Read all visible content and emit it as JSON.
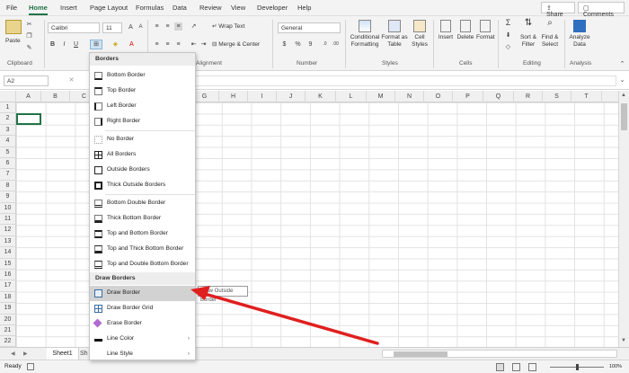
{
  "tabs": [
    "File",
    "Home",
    "Insert",
    "Page Layout",
    "Formulas",
    "Data",
    "Review",
    "View",
    "Developer",
    "Help"
  ],
  "share_label": "Share",
  "comments_label": "Comments",
  "clipboard": {
    "paste": "Paste",
    "label": "Clipboard"
  },
  "font": {
    "name": "Calibri",
    "size": "11",
    "bold": "B",
    "italic": "I",
    "underline": "U"
  },
  "alignment": {
    "wrap": "Wrap Text",
    "merge": "Merge & Center",
    "label": "Alignment"
  },
  "number": {
    "format": "General",
    "currency": "$",
    "percent": "%",
    "comma": "9",
    "label": "Number"
  },
  "styles": {
    "conditional": [
      "Conditional",
      "Formatting"
    ],
    "table": [
      "Format as",
      "Table"
    ],
    "cell": [
      "Cell",
      "Styles"
    ],
    "label": "Styles"
  },
  "cells": {
    "insert": "Insert",
    "delete": "Delete",
    "format": "Format",
    "label": "Cells"
  },
  "editing": {
    "sort": [
      "Sort &",
      "Filter"
    ],
    "find": [
      "Find &",
      "Select"
    ],
    "label": "Editing",
    "sum": "Σ"
  },
  "analysis": {
    "analyze": [
      "Analyze",
      "Data"
    ],
    "label": "Analysis"
  },
  "formula_bar": {
    "name_box": "A2",
    "fx": "fx"
  },
  "columns": [
    "A",
    "B",
    "C",
    "D",
    "E",
    "F",
    "G",
    "H",
    "I",
    "J",
    "K",
    "L",
    "M",
    "N",
    "O",
    "P",
    "Q",
    "R",
    "S",
    "T"
  ],
  "rows": [
    "1",
    "2",
    "3",
    "4",
    "5",
    "6",
    "7",
    "8",
    "9",
    "10",
    "11",
    "12",
    "13",
    "14",
    "15",
    "16",
    "17",
    "18",
    "19",
    "20",
    "21",
    "22"
  ],
  "sheet_tabs": [
    "Sheet1",
    "Sh"
  ],
  "status": {
    "ready": "Ready",
    "zoom": "100%"
  },
  "menu": {
    "borders_heading": "Borders",
    "draw_heading": "Draw Borders",
    "items_a": [
      "Bottom Border",
      "Top Border",
      "Left Border",
      "Right Border"
    ],
    "items_b": [
      "No Border",
      "All Borders",
      "Outside Borders",
      "Thick Outside Borders"
    ],
    "items_c": [
      "Bottom Double Border",
      "Thick Bottom Border",
      "Top and Bottom Border",
      "Top and Thick Bottom Border",
      "Top and Double Bottom Border"
    ],
    "items_d": [
      "Draw Border",
      "Draw Border Grid",
      "Erase Border",
      "Line Color",
      "Line Style"
    ]
  },
  "tooltip": "Draw Outside Border",
  "colors": {
    "accent": "#217346",
    "arrow": "#e01f1f",
    "highlight": "#d2d2d2"
  }
}
